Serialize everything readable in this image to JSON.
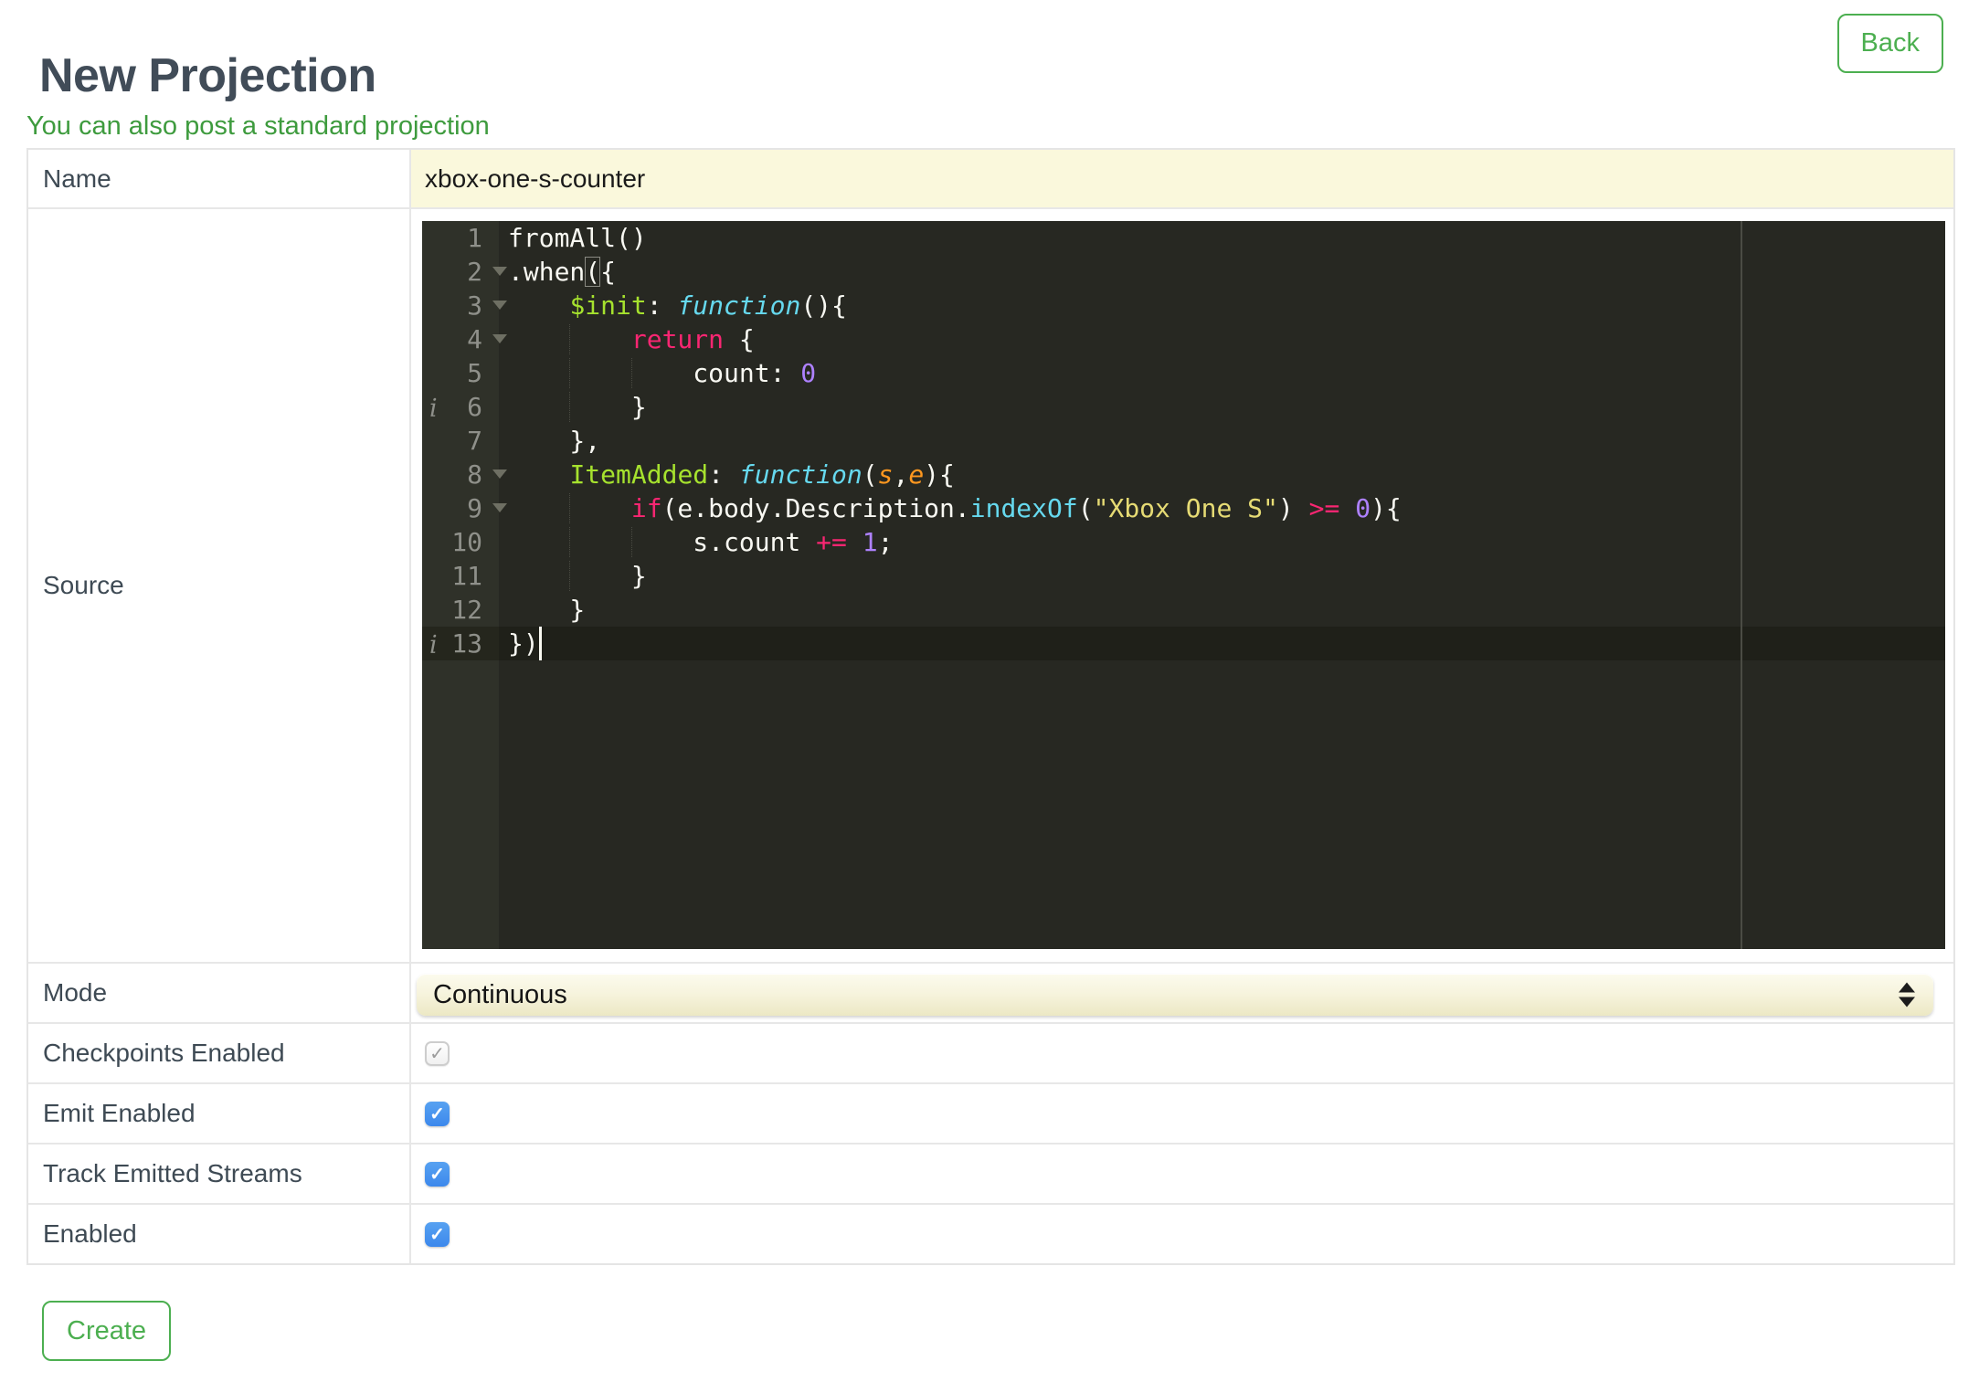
{
  "page": {
    "title": "New Projection",
    "back_label": "Back",
    "link_text": "You can also post a standard projection",
    "create_label": "Create"
  },
  "form": {
    "name": {
      "label": "Name",
      "value": "xbox-one-s-counter"
    },
    "source_label": "Source",
    "mode": {
      "label": "Mode",
      "value": "Continuous"
    },
    "checkboxes": [
      {
        "label": "Checkpoints Enabled",
        "checked": true,
        "disabled": true
      },
      {
        "label": "Emit Enabled",
        "checked": true,
        "disabled": false
      },
      {
        "label": "Track Emitted Streams",
        "checked": true,
        "disabled": false
      },
      {
        "label": "Enabled",
        "checked": true,
        "disabled": false
      }
    ],
    "check_glyph": "✓"
  },
  "editor": {
    "active_line": 13,
    "print_margin_column": 80,
    "info_glyph": "i",
    "lines": [
      {
        "num": 1,
        "fold": false,
        "info": false,
        "segments": [
          [
            "fromAll()",
            "plain"
          ]
        ]
      },
      {
        "num": 2,
        "fold": true,
        "info": false,
        "segments": [
          [
            ".when",
            "plain"
          ],
          [
            "(",
            "bracket"
          ],
          [
            "{",
            "plain"
          ]
        ]
      },
      {
        "num": 3,
        "fold": true,
        "info": false,
        "segments": [
          [
            "    ",
            "plain"
          ],
          [
            "$init",
            "lime"
          ],
          [
            ": ",
            "plain"
          ],
          [
            "function",
            "cyan-italic"
          ],
          [
            "(){",
            "plain"
          ]
        ]
      },
      {
        "num": 4,
        "fold": true,
        "info": false,
        "segments": [
          [
            "        ",
            "plain"
          ],
          [
            "return",
            "pink"
          ],
          [
            " {",
            "plain"
          ]
        ]
      },
      {
        "num": 5,
        "fold": false,
        "info": false,
        "segments": [
          [
            "            count: ",
            "plain"
          ],
          [
            "0",
            "purple"
          ]
        ]
      },
      {
        "num": 6,
        "fold": false,
        "info": true,
        "segments": [
          [
            "        }",
            "plain"
          ]
        ]
      },
      {
        "num": 7,
        "fold": false,
        "info": false,
        "segments": [
          [
            "    },",
            "plain"
          ]
        ]
      },
      {
        "num": 8,
        "fold": true,
        "info": false,
        "segments": [
          [
            "    ",
            "plain"
          ],
          [
            "ItemAdded",
            "lime"
          ],
          [
            ": ",
            "plain"
          ],
          [
            "function",
            "cyan-italic"
          ],
          [
            "(",
            "plain"
          ],
          [
            "s",
            "orange-italic"
          ],
          [
            ",",
            "plain"
          ],
          [
            "e",
            "orange-italic"
          ],
          [
            "){",
            "plain"
          ]
        ]
      },
      {
        "num": 9,
        "fold": true,
        "info": false,
        "segments": [
          [
            "        ",
            "plain"
          ],
          [
            "if",
            "pink"
          ],
          [
            "(e.body.Description.",
            "plain"
          ],
          [
            "indexOf",
            "cyan"
          ],
          [
            "(",
            "plain"
          ],
          [
            "\"Xbox One S\"",
            "string"
          ],
          [
            ") ",
            "plain"
          ],
          [
            ">=",
            "pink"
          ],
          [
            " ",
            "plain"
          ],
          [
            "0",
            "purple"
          ],
          [
            "){",
            "plain"
          ]
        ]
      },
      {
        "num": 10,
        "fold": false,
        "info": false,
        "segments": [
          [
            "            s.count ",
            "plain"
          ],
          [
            "+=",
            "pink"
          ],
          [
            " ",
            "plain"
          ],
          [
            "1",
            "purple"
          ],
          [
            ";",
            "plain"
          ]
        ]
      },
      {
        "num": 11,
        "fold": false,
        "info": false,
        "segments": [
          [
            "        }",
            "plain"
          ]
        ]
      },
      {
        "num": 12,
        "fold": false,
        "info": false,
        "segments": [
          [
            "    }",
            "plain"
          ]
        ]
      },
      {
        "num": 13,
        "fold": false,
        "info": true,
        "segments": [
          [
            "})",
            "plain"
          ]
        ]
      }
    ]
  },
  "colors": {
    "green_accent": "#4CAF50",
    "link_green": "#3E9B3E",
    "heading_color": "#414C58",
    "label_color": "#3E4A54",
    "name_row_bg": "#FAF8DC",
    "checkbox_blue": "#4690EE",
    "editor_bg": "#272822",
    "gutter_bg": "#2F3129"
  }
}
